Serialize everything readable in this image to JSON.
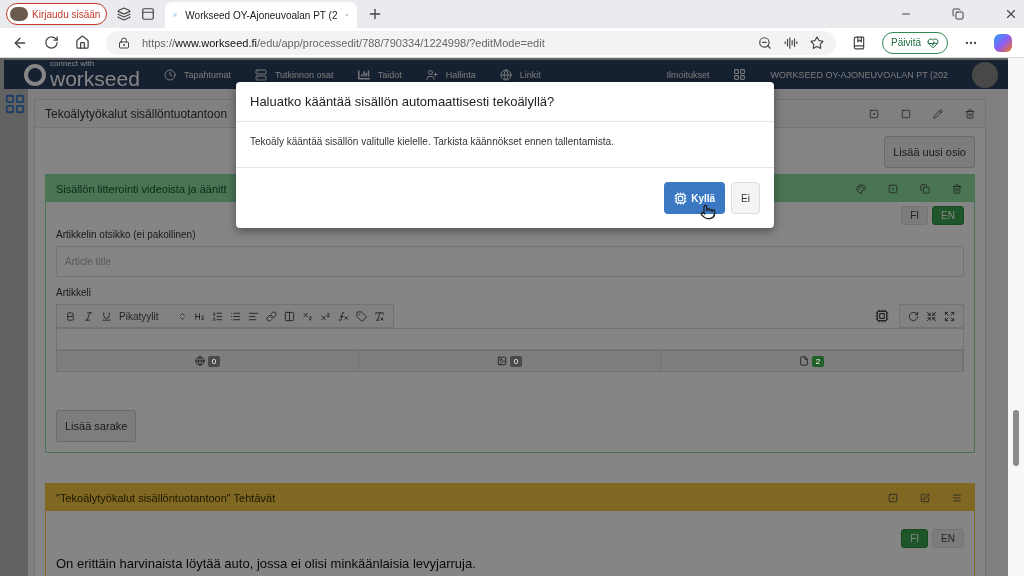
{
  "browser": {
    "profile_button": "Kirjaudu sisään",
    "tabs": [
      {
        "title": "Workseed OY-Ajoneuvoalan PT (2",
        "selected": true
      }
    ],
    "url": "https://**www.workseed.fi**/edu/app/processedit/788/790334/1224998/?editMode=edit",
    "update_button": "Päivitä"
  },
  "navbar": {
    "logo": "workseed",
    "logo_tagline": "connect with",
    "items": [
      "Tapahtumat",
      "Tutkinnon osat",
      "Taidot",
      "Hallinta",
      "Linkit"
    ],
    "notifications": "Ilmoitukset",
    "organization": "WORKSEED OY-AJONEUVOALAN PT (202"
  },
  "card": {
    "title": "Tekoälytyökalut sisällöntuotantoon",
    "add_section_button": "Lisää uusi osio"
  },
  "section": {
    "title": "Sisällön litterointi videoista ja äänitt",
    "languages": [
      {
        "label": "FI",
        "selected": false
      },
      {
        "label": "EN",
        "selected": true
      }
    ],
    "title_label": "Artikkelin otsikko (ei pakollinen)",
    "title_placeholder": "Article title",
    "article_label": "Artikkeli",
    "style_dropdown": "Pikatyylit",
    "attachments": [
      {
        "count": "0",
        "color": "#4a4a4a"
      },
      {
        "count": "0",
        "color": "#4a4a4a"
      },
      {
        "count": "2",
        "color": "#22602a"
      }
    ],
    "add_column_button": "Lisää sarake"
  },
  "tasks": {
    "title": "\"Tekoälytyökalut sisällöntuotantoon\" Tehtävät",
    "languages": [
      {
        "label": "FI",
        "selected": true
      },
      {
        "label": "EN",
        "selected": false
      }
    ],
    "text": "On erittäin harvinaista löytää auto, jossa ei olisi minkäänlaisia levyjarruja."
  },
  "dialog": {
    "title": "Haluatko kääntää sisällön automaattisesti tekoälyllä?",
    "body": "Tekoäly kääntää sisällön valitulle kielelle. Tarkista käännökset ennen tallentamista.",
    "confirm_button": "Kyllä",
    "cancel_button": "Ei"
  }
}
